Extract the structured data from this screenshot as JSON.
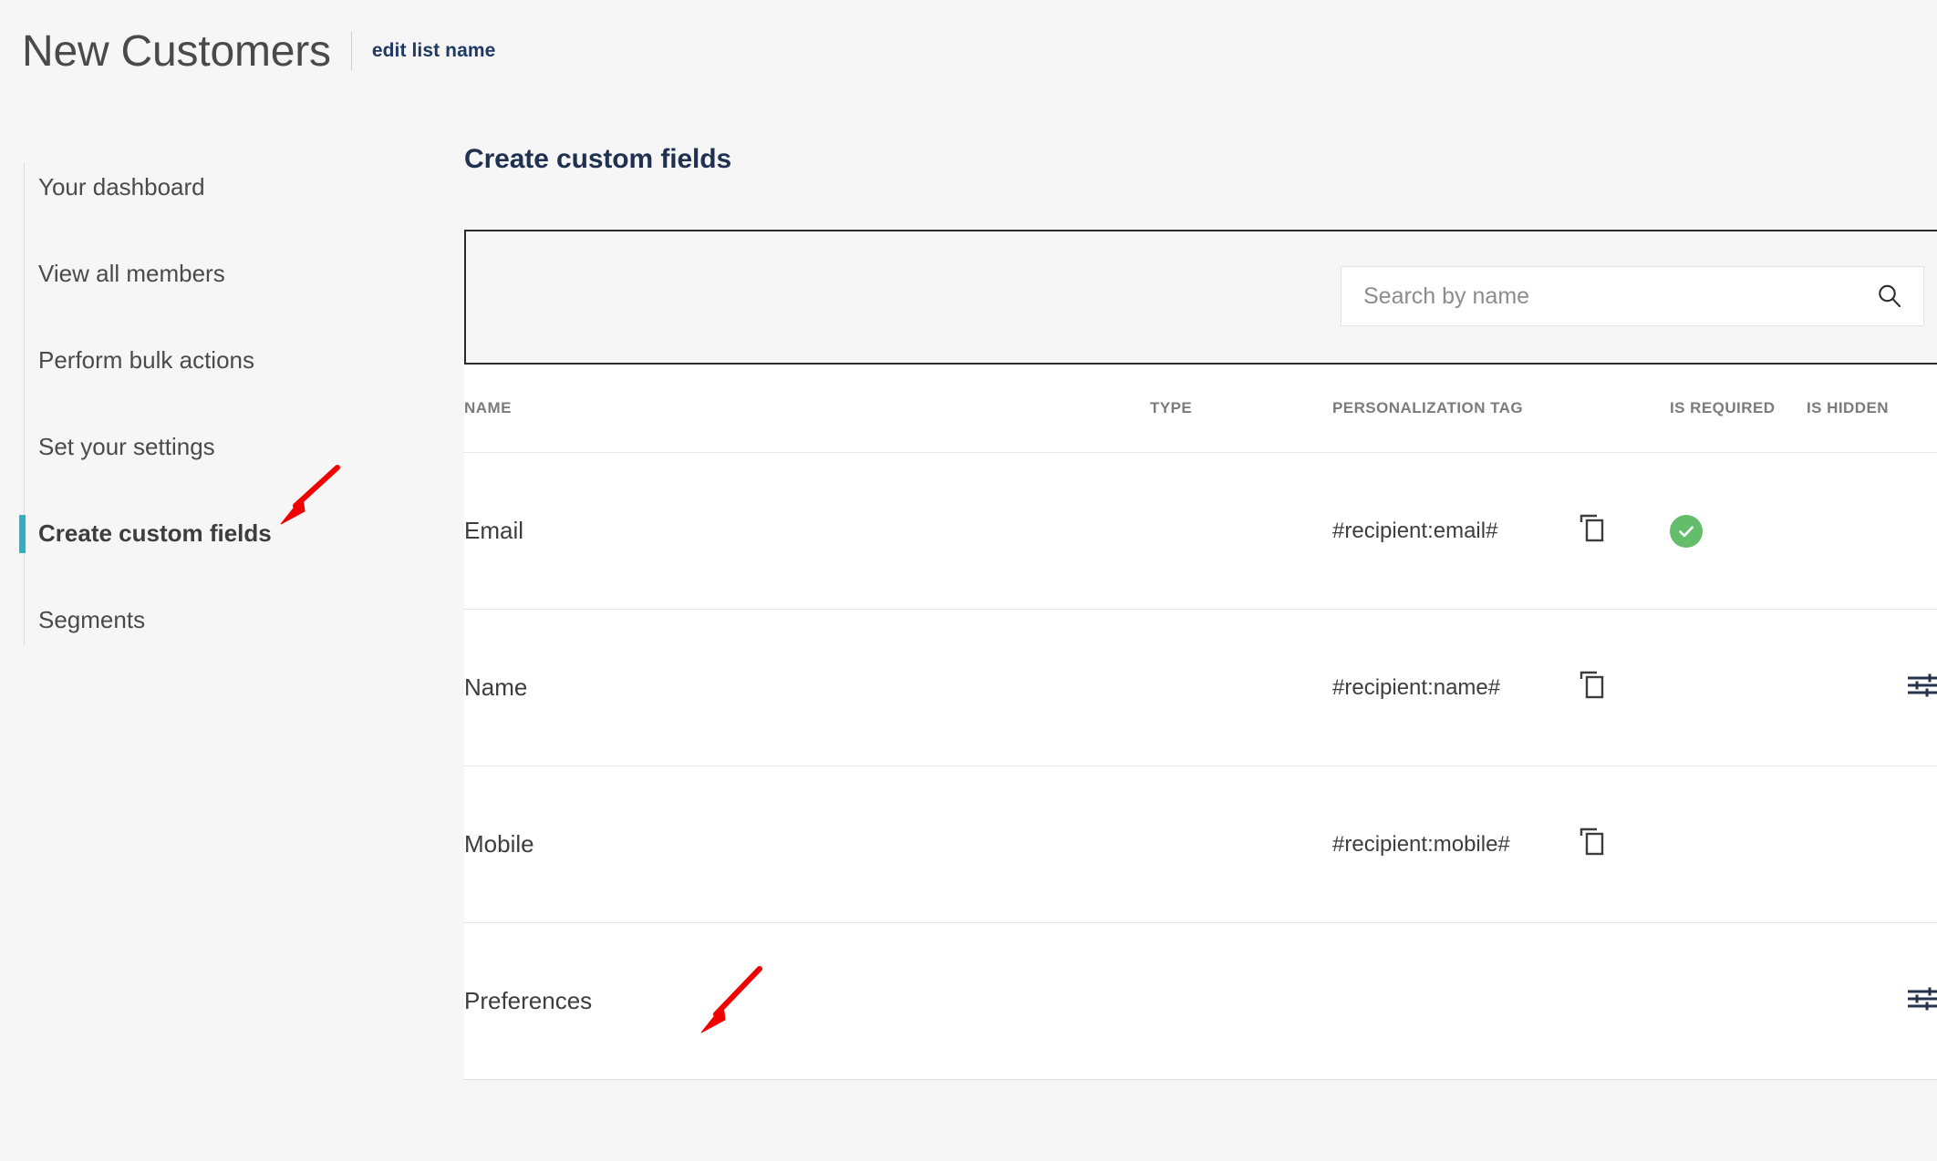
{
  "header": {
    "title": "New Customers",
    "edit_link": "edit list name"
  },
  "sidebar": {
    "items": [
      {
        "label": "Your dashboard",
        "active": false
      },
      {
        "label": "View all members",
        "active": false
      },
      {
        "label": "Perform bulk actions",
        "active": false
      },
      {
        "label": "Set your settings",
        "active": false
      },
      {
        "label": "Create custom fields",
        "active": true
      },
      {
        "label": "Segments",
        "active": false
      }
    ],
    "active_indicator_color": "#32aec4"
  },
  "main": {
    "section_title": "Create custom fields",
    "search": {
      "value": "",
      "placeholder": "Search by name",
      "icon": "search-icon"
    },
    "table": {
      "columns": [
        {
          "key": "name",
          "label": "NAME"
        },
        {
          "key": "type",
          "label": "TYPE"
        },
        {
          "key": "tag",
          "label": "PERSONALIZATION TAG"
        },
        {
          "key": "copy",
          "label": ""
        },
        {
          "key": "required",
          "label": "IS REQUIRED"
        },
        {
          "key": "hidden",
          "label": "IS HIDDEN"
        }
      ],
      "rows": [
        {
          "name": "Email",
          "type": "",
          "tag": "#recipient:email#",
          "copy_icon": "copy-icon",
          "is_required": true,
          "is_hidden_icon": false
        },
        {
          "name": "Name",
          "type": "",
          "tag": "#recipient:name#",
          "copy_icon": "copy-icon",
          "is_required": false,
          "is_hidden_icon": true
        },
        {
          "name": "Mobile",
          "type": "",
          "tag": "#recipient:mobile#",
          "copy_icon": "copy-icon",
          "is_required": false,
          "is_hidden_icon": false
        },
        {
          "name": "Preferences",
          "type": "",
          "tag": "",
          "copy_icon": "",
          "is_required": false,
          "is_hidden_icon": true
        }
      ]
    }
  },
  "annotations": {
    "color": "#f00000",
    "arrows": [
      {
        "name": "arrow-to-create-custom-fields"
      },
      {
        "name": "arrow-to-preferences"
      }
    ]
  },
  "colors": {
    "accent_teal": "#32aec4",
    "success_green": "#63bd6a",
    "annotation_red": "#f00000",
    "title_navy": "#1f3050",
    "page_background": "#f6f6f6"
  }
}
